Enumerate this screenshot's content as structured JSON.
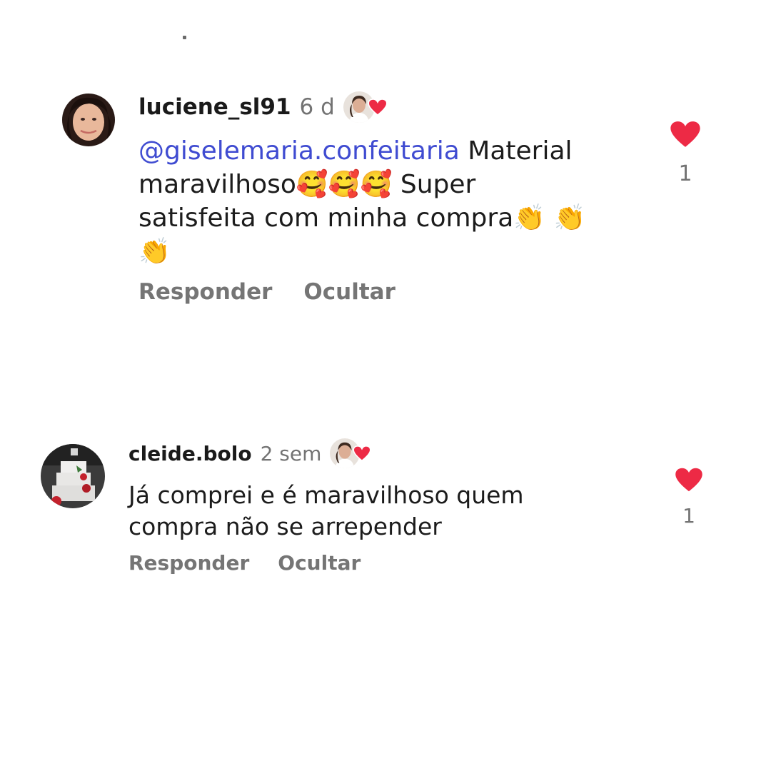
{
  "comments": [
    {
      "username": "luciene_sl91",
      "time": "6 d",
      "mention": "@giselemaria.confeitaria",
      "text_line1": " Material",
      "text_line2_a": "maravilhoso",
      "emoji_love": "🥰",
      "text_line2_b": " Super",
      "text_line3": "satisfeita com minha compra",
      "emoji_clap": "👏",
      "like_count": "1",
      "reply_label": "Responder",
      "hide_label": "Ocultar",
      "heart_color": "#ed2a45"
    },
    {
      "username": "cleide.bolo",
      "time": "2 sem",
      "text_line1": "Já comprei e é maravilhoso quem",
      "text_line2": "compra não se arrepender",
      "like_count": "1",
      "reply_label": "Responder",
      "hide_label": "Ocultar",
      "heart_color": "#ed2a45"
    }
  ],
  "icons": {
    "liked_heart": "heart-icon",
    "creator_heart": "heart-icon"
  }
}
